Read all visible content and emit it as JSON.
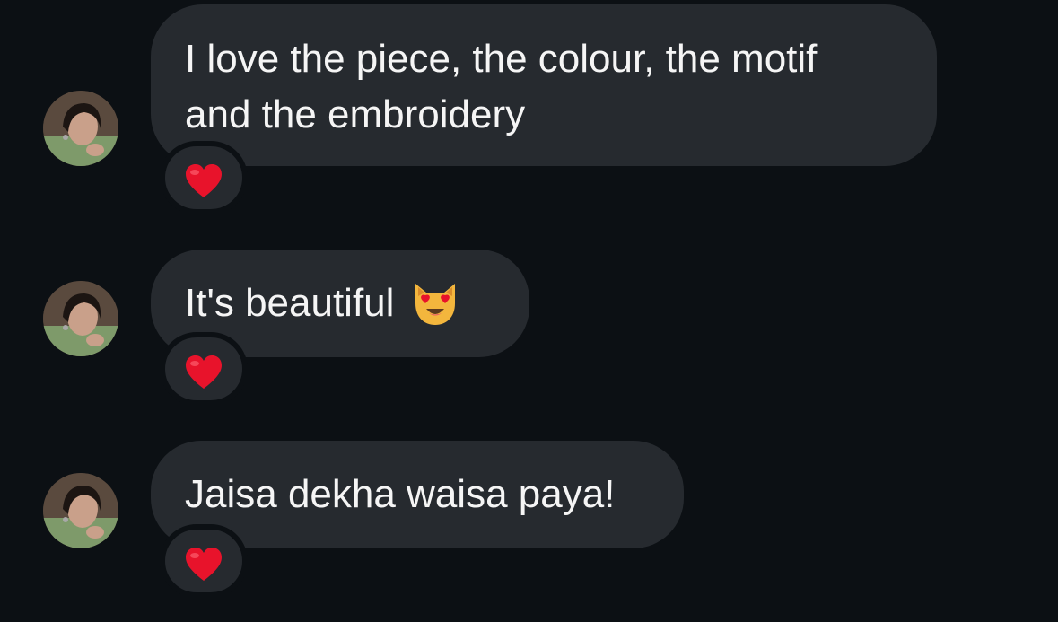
{
  "messages": [
    {
      "text_lines": [
        "I love the piece, the colour, the motif",
        "and the embroidery"
      ],
      "reaction": "red-heart"
    },
    {
      "text": "It's beautiful",
      "emoji": "heart-eyes-cat",
      "reaction": "red-heart"
    },
    {
      "text": "Jaisa dekha waisa paya!",
      "reaction": "red-heart"
    }
  ],
  "colors": {
    "background": "#0c1014",
    "bubble": "#262a2f",
    "text": "#f5f5f5",
    "heart": "#e8132b"
  }
}
